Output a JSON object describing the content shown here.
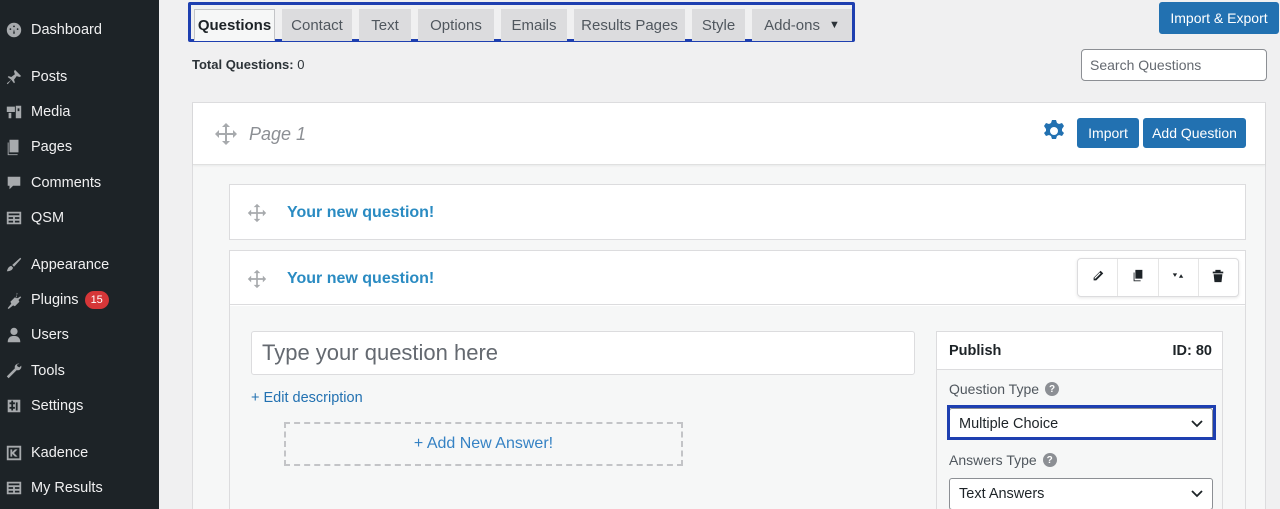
{
  "sidebar": {
    "items": [
      {
        "label": "Dashboard",
        "icon": "dashboard-icon"
      },
      {
        "label": "Posts",
        "icon": "pin-icon"
      },
      {
        "label": "Media",
        "icon": "media-icon"
      },
      {
        "label": "Pages",
        "icon": "pages-icon"
      },
      {
        "label": "Comments",
        "icon": "comment-icon"
      },
      {
        "label": "QSM",
        "icon": "qsm-icon"
      },
      {
        "label": "Appearance",
        "icon": "brush-icon"
      },
      {
        "label": "Plugins",
        "icon": "plug-icon",
        "badge": "15"
      },
      {
        "label": "Users",
        "icon": "user-icon"
      },
      {
        "label": "Tools",
        "icon": "wrench-icon"
      },
      {
        "label": "Settings",
        "icon": "settings-icon"
      },
      {
        "label": "Kadence",
        "icon": "kadence-icon"
      },
      {
        "label": "My Results",
        "icon": "results-icon"
      }
    ]
  },
  "tabs": [
    "Questions",
    "Contact",
    "Text",
    "Options",
    "Emails",
    "Results Pages",
    "Style",
    "Add-ons"
  ],
  "toolbar": {
    "import_export": "Import & Export"
  },
  "total": {
    "label": "Total Questions:",
    "value": "0"
  },
  "search": {
    "placeholder": "Search Questions"
  },
  "page": {
    "title": "Page 1",
    "import_label": "Import",
    "add_question_label": "Add Question"
  },
  "questions": [
    {
      "title": "Your new question!"
    },
    {
      "title": "Your new question!"
    }
  ],
  "editor": {
    "question_placeholder": "Type your question here",
    "edit_description": "+ Edit description",
    "add_answer": "+ Add New Answer!"
  },
  "publish": {
    "label": "Publish",
    "id": "ID: 80",
    "question_type_label": "Question Type",
    "question_type_value": "Multiple Choice",
    "answers_type_label": "Answers Type",
    "answers_type_value": "Text Answers"
  },
  "colors": {
    "sidebar": "#1d2327",
    "accent": "#2271b1",
    "highlight": "#1e3fb0",
    "badge": "#d63638"
  }
}
